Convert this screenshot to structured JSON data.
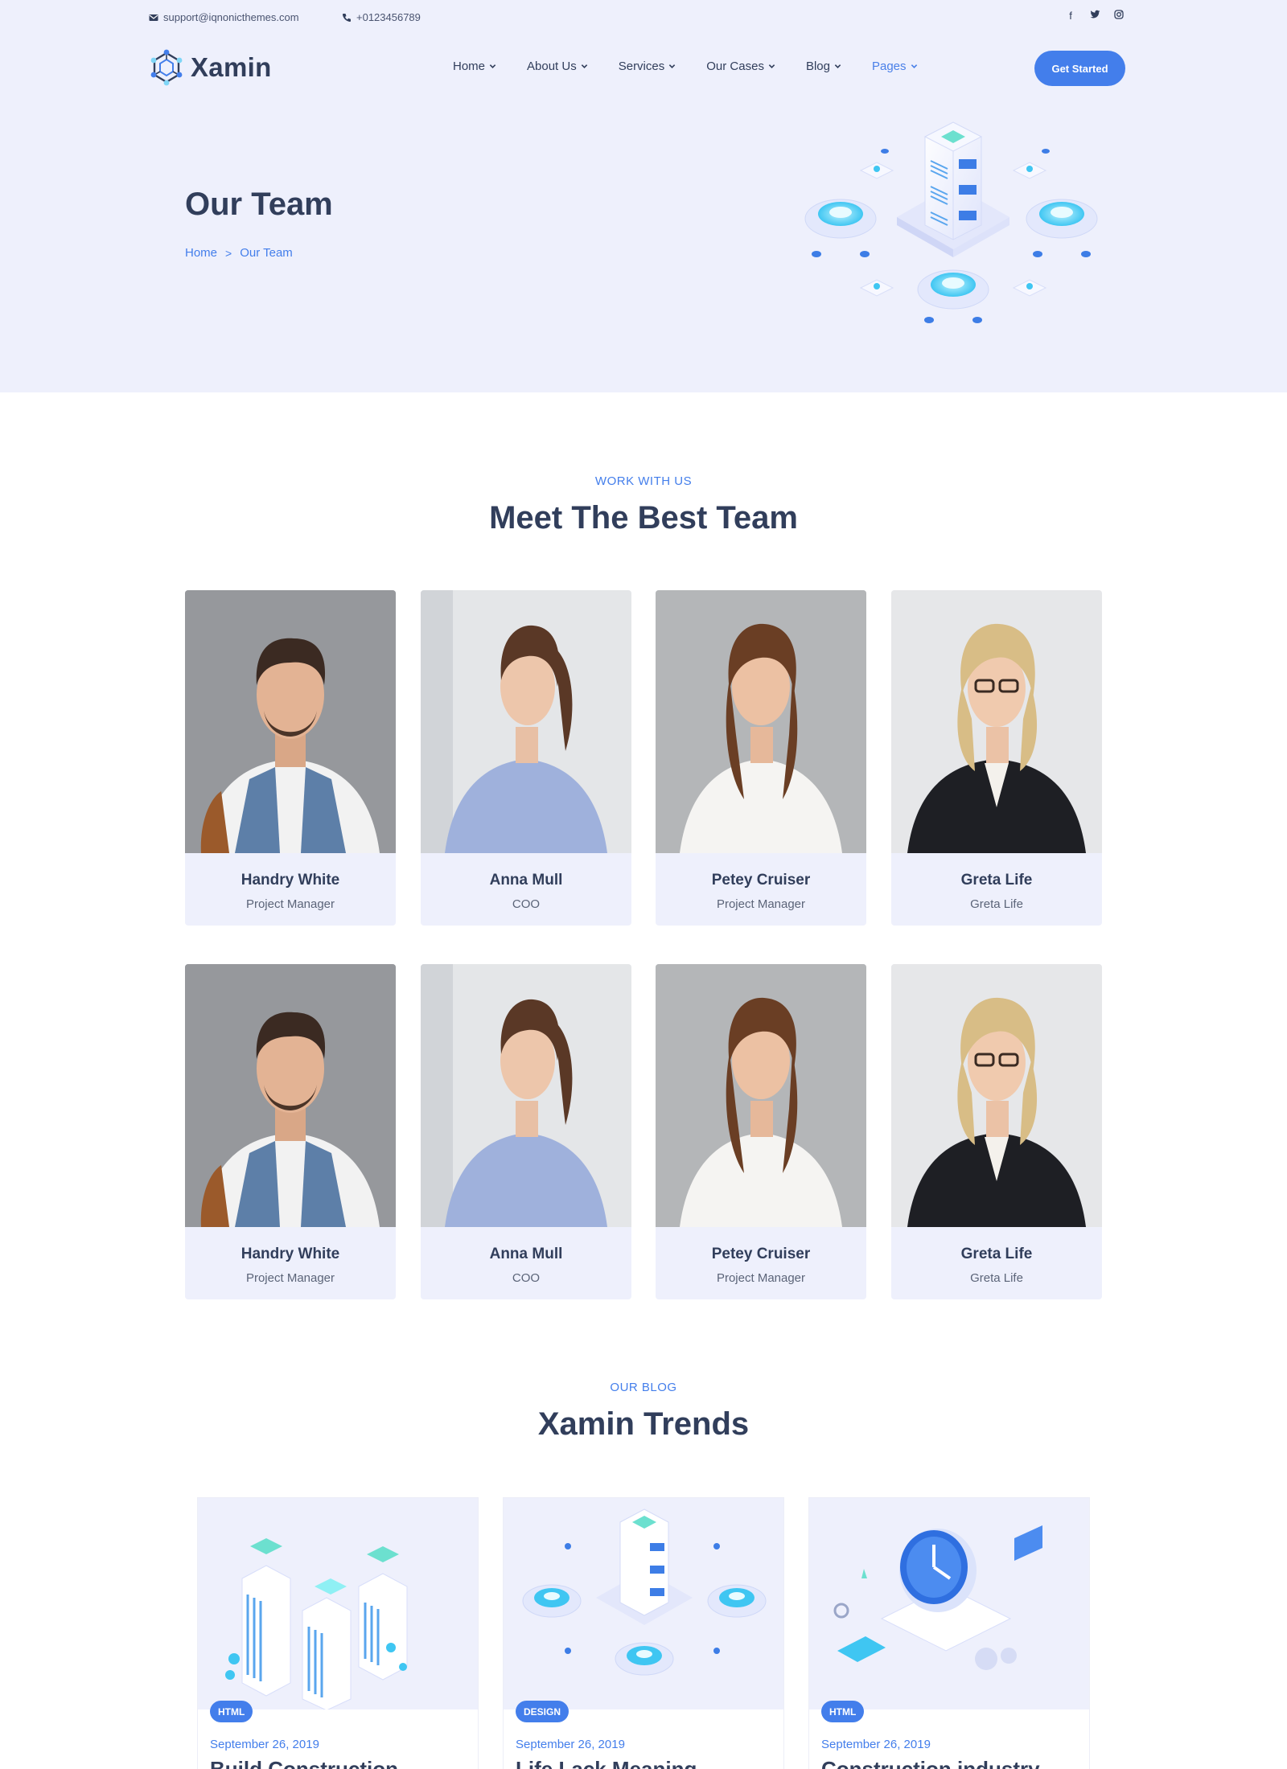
{
  "topbar": {
    "email": "support@iqnonicthemes.com",
    "phone": "+0123456789",
    "socials": [
      "facebook-icon",
      "twitter-icon",
      "instagram-icon"
    ]
  },
  "brand": {
    "name": "Xamin"
  },
  "nav": {
    "items": [
      {
        "label": "Home"
      },
      {
        "label": "About Us"
      },
      {
        "label": "Services"
      },
      {
        "label": "Our Cases"
      },
      {
        "label": "Blog"
      },
      {
        "label": "Pages"
      }
    ],
    "active_item": "Pages",
    "cta_label": "Get Started"
  },
  "hero": {
    "title": "Our Team",
    "breadcrumb": {
      "home": "Home",
      "separator": ">",
      "current": "Our Team"
    }
  },
  "team_section": {
    "eyebrow": "WORK WITH US",
    "title": "Meet The Best Team",
    "members": [
      {
        "name": "Handry White",
        "role": "Project Manager"
      },
      {
        "name": "Anna Mull",
        "role": "COO"
      },
      {
        "name": "Petey Cruiser",
        "role": "Project Manager"
      },
      {
        "name": "Greta Life",
        "role": "Greta Life"
      },
      {
        "name": "Handry White",
        "role": "Project Manager"
      },
      {
        "name": "Anna Mull",
        "role": "COO"
      },
      {
        "name": "Petey Cruiser",
        "role": "Project Manager"
      },
      {
        "name": "Greta Life",
        "role": "Greta Life"
      }
    ]
  },
  "blog_section": {
    "eyebrow": "OUR BLOG",
    "title": "Xamin Trends",
    "posts": [
      {
        "tag": "HTML",
        "date": "September 26, 2019",
        "title": "Build Construction"
      },
      {
        "tag": "DESIGN",
        "date": "September 26, 2019",
        "title": "Life Lack Meaning"
      },
      {
        "tag": "HTML",
        "date": "September 26, 2019",
        "title": "Construction industry"
      }
    ]
  },
  "colors": {
    "accent": "#437eeb",
    "hero_bg": "#eef0fc",
    "heading": "#313e5b"
  }
}
